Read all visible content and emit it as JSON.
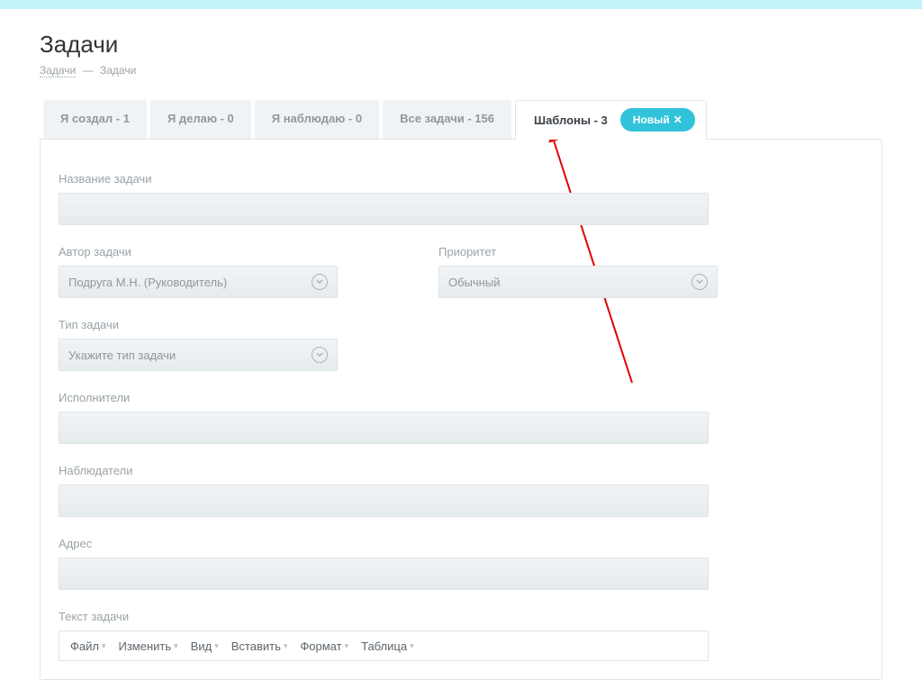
{
  "page_title": "Задачи",
  "breadcrumb": {
    "link": "Задачи",
    "sep": "—",
    "current": "Задачи"
  },
  "tabs": [
    {
      "label": "Я создал - 1"
    },
    {
      "label": "Я делаю - 0"
    },
    {
      "label": "Я наблюдаю - 0"
    },
    {
      "label": "Все задачи - 156"
    },
    {
      "label": "Шаблоны - 3",
      "active": true
    }
  ],
  "new_button": "Новый",
  "form": {
    "task_name_label": "Название задачи",
    "author_label": "Автор задачи",
    "author_value": "Подруга М.Н. (Руководитель)",
    "priority_label": "Приоритет",
    "priority_value": "Обычный",
    "type_label": "Тип задачи",
    "type_placeholder": "Укажите тип задачи",
    "executors_label": "Исполнители",
    "watchers_label": "Наблюдатели",
    "address_label": "Адрес",
    "text_label": "Текст задачи"
  },
  "editor_toolbar": {
    "file": "Файл",
    "edit": "Изменить",
    "view": "Вид",
    "insert": "Вставить",
    "format": "Формат",
    "table": "Таблица"
  }
}
